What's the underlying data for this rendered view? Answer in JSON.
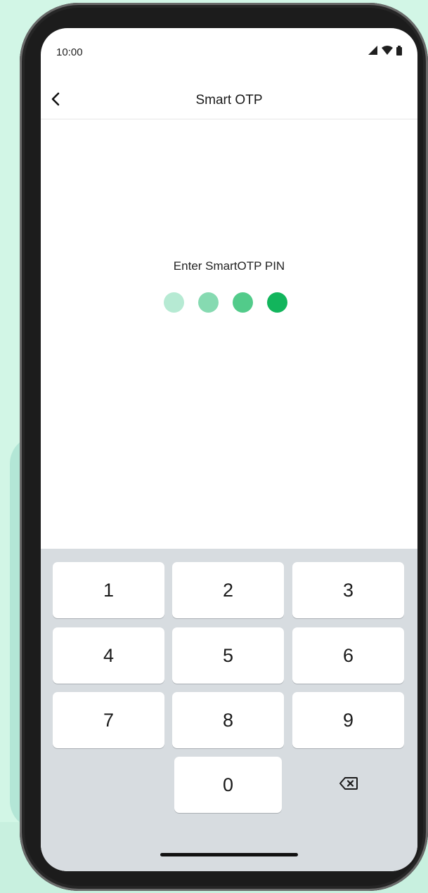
{
  "status_bar": {
    "time": "10:00",
    "icons": [
      "signal-icon",
      "wifi-icon",
      "battery-icon"
    ]
  },
  "app_bar": {
    "back_icon": "chevron-left-icon",
    "title": "Smart OTP"
  },
  "pin": {
    "prompt": "Enter SmartOTP PIN",
    "length": 4,
    "dot_colors": [
      "#b6ead3",
      "#86dab1",
      "#52cb8a",
      "#12b55c"
    ]
  },
  "keypad": {
    "rows": [
      [
        "1",
        "2",
        "3"
      ],
      [
        "4",
        "5",
        "6"
      ],
      [
        "7",
        "8",
        "9"
      ],
      [
        "",
        "0",
        "backspace"
      ]
    ],
    "backspace_icon": "backspace-icon"
  },
  "colors": {
    "accent": "#12b55c",
    "keypad_bg": "#d7dce0",
    "page_bg": "#d2f6e6"
  }
}
